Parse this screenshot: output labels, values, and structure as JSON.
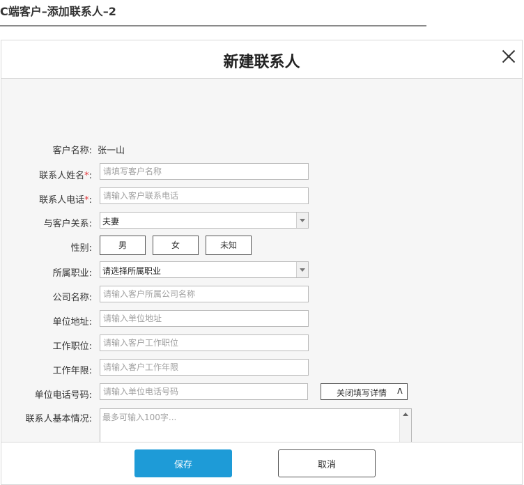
{
  "page": {
    "title": "C端客户–添加联系人–2"
  },
  "dialog": {
    "title": "新建联系人",
    "close_label": "×",
    "fields": {
      "customer_name": {
        "label": "客户名称:",
        "value": "张一山"
      },
      "contact_name": {
        "label": "联系人姓名",
        "required_mark": "*",
        "colon": ":",
        "placeholder": "请填写客户名称"
      },
      "contact_phone": {
        "label": "联系人电话",
        "required_mark": "*",
        "colon": ":",
        "placeholder": "请输入客户联系电话"
      },
      "relation": {
        "label": "与客户关系:",
        "selected": "夫妻"
      },
      "gender": {
        "label": "性别:",
        "options": [
          "男",
          "女",
          "未知"
        ]
      },
      "occupation": {
        "label": "所属职业:",
        "selected": "请选择所属职业"
      },
      "company_name": {
        "label": "公司名称:",
        "placeholder": "请输入客户所属公司名称"
      },
      "company_address": {
        "label": "单位地址:",
        "placeholder": "请输入单位地址"
      },
      "job_title": {
        "label": "工作职位:",
        "placeholder": "请输入客户工作职位"
      },
      "work_years": {
        "label": "工作年限:",
        "placeholder": "请输入客户工作年限"
      },
      "company_phone": {
        "label": "单位电话号码:",
        "placeholder": "请输入单位电话号码"
      },
      "basic_info": {
        "label": "联系人基本情况:",
        "placeholder": "最多可输入100字..."
      }
    },
    "toggle_details": {
      "label": "关闭填写详情",
      "icon": "ʌ"
    },
    "buttons": {
      "save": "保存",
      "cancel": "取消"
    },
    "colors": {
      "primary": "#1e9bd7",
      "required": "#e4393c"
    }
  }
}
